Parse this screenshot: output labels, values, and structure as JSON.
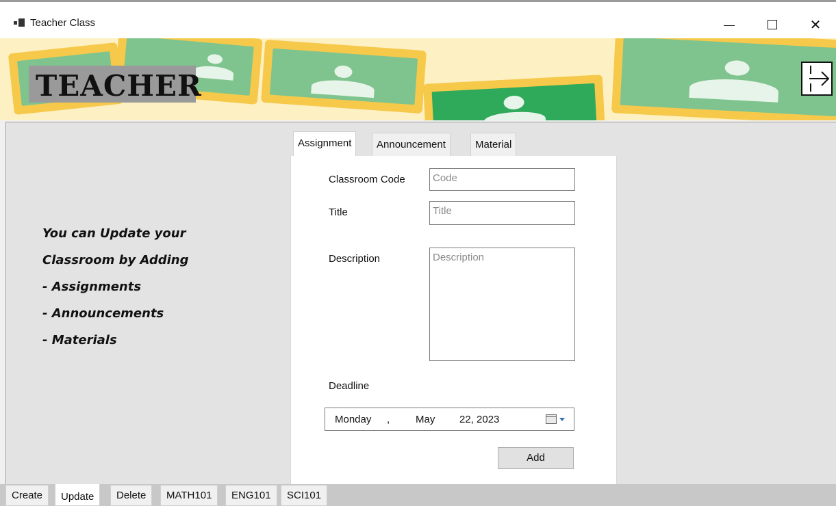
{
  "window": {
    "title": "Teacher Class",
    "minimize_symbol": "—",
    "maximize_symbol": "☐",
    "close_symbol": "✕"
  },
  "banner": {
    "heading": "TEACHER"
  },
  "info": {
    "lines": [
      "You can Update your",
      "Classroom by Adding",
      "- Assignments",
      "- Announcements",
      "- Materials"
    ]
  },
  "inner_tabs": [
    {
      "label": "Assignment",
      "active": true
    },
    {
      "label": "Announcement",
      "active": false
    },
    {
      "label": "Material",
      "active": false
    }
  ],
  "form": {
    "classroom_code_label": "Classroom Code",
    "classroom_code_placeholder": "Code",
    "title_label": "Title",
    "title_placeholder": "Title",
    "description_label": "Description",
    "description_placeholder": "Description",
    "deadline_label": "Deadline",
    "deadline": {
      "weekday": "Monday",
      "sep": ",",
      "month": "May",
      "day_year": "22, 2023"
    },
    "add_button": "Add"
  },
  "bottom_tabs": [
    {
      "label": "Create",
      "active": false
    },
    {
      "label": "Update",
      "active": true
    },
    {
      "label": "Delete",
      "active": false
    },
    {
      "label": "MATH101",
      "active": false
    },
    {
      "label": "ENG101",
      "active": false
    },
    {
      "label": "SCI101",
      "active": false
    }
  ],
  "icons": {
    "app_icon": "windows-app-icon",
    "logout_icon": "logout-arrow-icon",
    "calendar_icon": "calendar-icon"
  },
  "colors": {
    "banner_bg": "#fdf0c2",
    "board_frame": "#f6c94b",
    "board_green": "#7fc48e",
    "board_green_dark": "#2eaa5a"
  }
}
